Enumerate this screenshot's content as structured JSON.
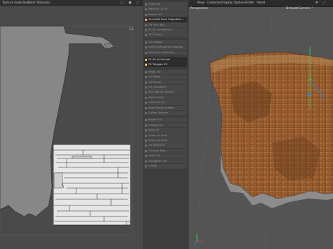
{
  "menubar": {
    "left_items": [
      "Texture Selection",
      "Paint",
      "Textures"
    ],
    "viewport_items": [
      "View",
      "Cameras",
      "Display",
      "Options",
      "Filter",
      "Panel"
    ]
  },
  "uv_panel": {
    "corner_label": "1,1"
  },
  "command_panel": {
    "items": [
      {
        "label": "Equal UV",
        "type": "group"
      },
      {
        "label": "Mesh to UV Fit",
        "type": "group"
      },
      {
        "label": "Rotate UV",
        "type": "group"
      },
      {
        "label": "Set UVW From Projection...",
        "type": "head"
      },
      {
        "label": "UV Pins Tool",
        "type": "group"
      },
      {
        "label": "Fit UV to Selection",
        "type": "group"
      },
      {
        "label": "Fit Canvas",
        "type": "group"
      },
      {
        "label": "",
        "type": "spacer"
      },
      {
        "label": "Flip Region",
        "type": "group"
      },
      {
        "label": "Build Orthogonal Mapping",
        "type": "group"
      },
      {
        "label": "Map From Selection",
        "type": "group"
      },
      {
        "label": "",
        "type": "spacer"
      },
      {
        "label": "Fit UV to Canvas",
        "type": "head"
      },
      {
        "label": "Fit Polygon UV",
        "type": "head"
      },
      {
        "label": "",
        "type": "spacer"
      },
      {
        "label": "Relax UV",
        "type": "group"
      },
      {
        "label": "UV Mirror",
        "type": "group"
      },
      {
        "label": "Cut Seam",
        "type": "group"
      },
      {
        "label": "UV Transform",
        "type": "group"
      },
      {
        "label": "Pick Manual Seams",
        "type": "group"
      },
      {
        "label": "Weld Points",
        "type": "group"
      },
      {
        "label": "Optimize UV",
        "type": "group"
      },
      {
        "label": "Bake Seam to Mesh",
        "type": "group"
      },
      {
        "label": "Collect Texture",
        "type": "group"
      },
      {
        "label": "",
        "type": "spacer"
      },
      {
        "label": "Project UV",
        "type": "group"
      },
      {
        "label": "Unwrap UV",
        "type": "group"
      },
      {
        "label": "Pack UV",
        "type": "group"
      },
      {
        "label": "Show UV Grid",
        "type": "group"
      },
      {
        "label": "Show UV Shell",
        "type": "group"
      },
      {
        "label": "UV Statistics",
        "type": "group"
      },
      {
        "label": "Checker Map",
        "type": "group"
      },
      {
        "label": "Stitch UV",
        "type": "group"
      },
      {
        "label": "Straighten UV",
        "type": "group"
      },
      {
        "label": "Unfold",
        "type": "group"
      }
    ]
  },
  "viewport": {
    "title": "Perspective",
    "camera": "Default Camera °"
  },
  "colors": {
    "accent_yellow": "#f2c14e",
    "axis_green": "#3cc84a",
    "axis_blue": "#3a7bd5",
    "axis_red": "#d84a3a"
  }
}
